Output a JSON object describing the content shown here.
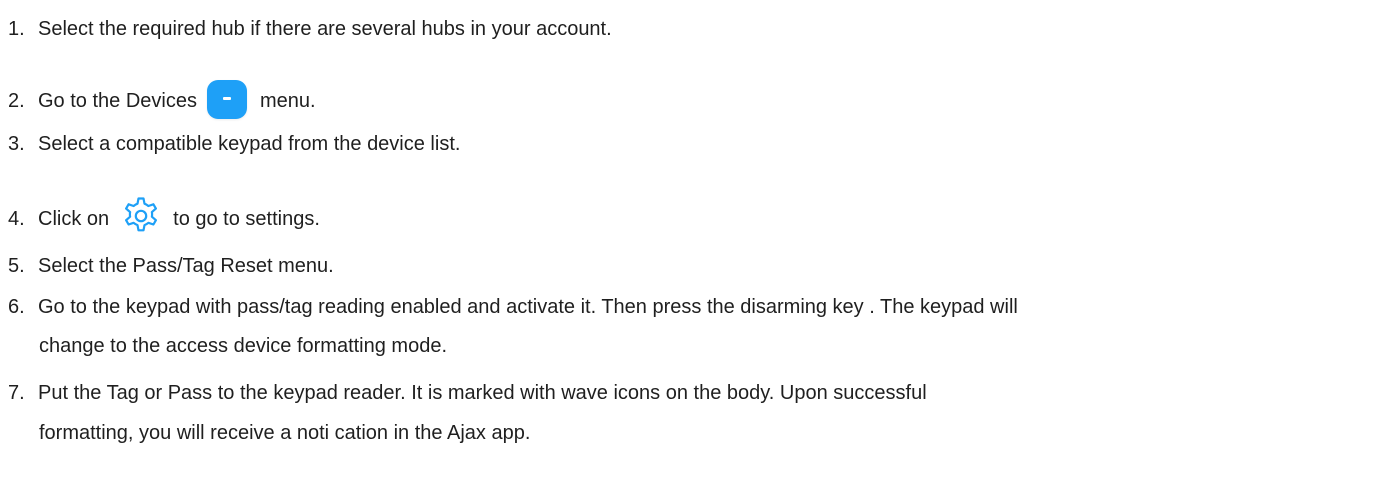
{
  "steps": [
    {
      "num": "1.",
      "text": "Select the required hub if there are several hubs in your account."
    },
    {
      "num": "2.",
      "before": "Go to the Devices",
      "icon": "devices-menu-icon",
      "after": "menu."
    },
    {
      "num": "3.",
      "text": "Select a compatible keypad from the device list."
    },
    {
      "num": "4.",
      "before": "Click on",
      "icon": "gear-icon",
      "after": "to go to settings."
    },
    {
      "num": "5.",
      "text": "Select the Pass/Tag Reset menu."
    },
    {
      "num": "6.",
      "line1": "Go to the keypad with pass/tag reading enabled and activate it. Then press the disarming key . The keypad will",
      "line2": "change to the access device formatting mode."
    },
    {
      "num": "7.",
      "line1": "Put the Tag or Pass to the keypad reader. It is marked with wave icons on the body. Upon successful",
      "line2": "formatting, you will receive a noti cation in the Ajax app."
    }
  ],
  "colors": {
    "text": "#1f1f1f",
    "devices_icon_bg": "#1ea0f7",
    "gear_icon": "#1ea0f7"
  }
}
